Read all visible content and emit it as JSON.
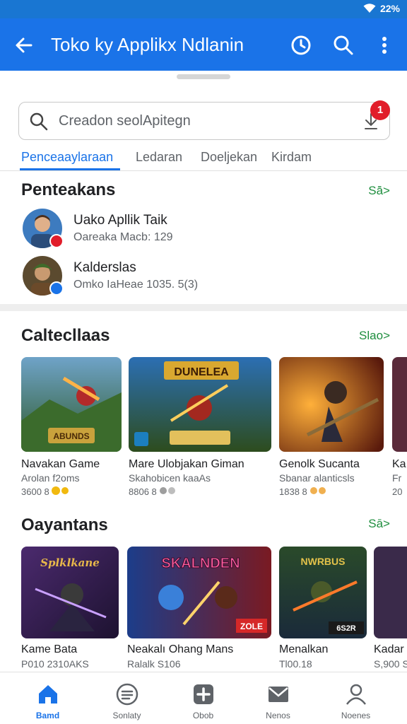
{
  "status": {
    "time": "22%"
  },
  "appbar": {
    "title": "Toko ky Applikx Ndlanin"
  },
  "search": {
    "placeholder": "Creadon seolApitegn",
    "badge": "1"
  },
  "tabs": [
    {
      "label": "Penceaaylaraan"
    },
    {
      "label": "Ledaran"
    },
    {
      "label": "Doeljekan"
    },
    {
      "label": "Kirdam"
    }
  ],
  "downloads": {
    "title": "Penteakans",
    "see_all": "Sā̄>",
    "items": [
      {
        "title": "Uako Apllik Taik",
        "sub": "Oareaka Macb: 129"
      },
      {
        "title": "Kalderslas",
        "sub": "Omko IaHeae 1035. 5(3)"
      }
    ]
  },
  "categories": {
    "title": "Caltecllaas",
    "see_all": "Slao>",
    "items": [
      {
        "title": "Navakan Game",
        "sub": "Arolan f2oms",
        "meta": "3600 8",
        "banner": "ABUNDS"
      },
      {
        "title": "Mare Ulobjakan Giman",
        "sub": "Skahobicen kaaAs",
        "meta": "8806 8",
        "banner": "DUNELEA"
      },
      {
        "title": "Genolk Sucanta",
        "sub": "Sbanar alanticsls",
        "meta": "1838 8",
        "banner": ""
      },
      {
        "title": "Ka",
        "sub": "Fr",
        "meta": "20",
        "banner": ""
      }
    ]
  },
  "popular": {
    "title": "Oayantans",
    "see_all": "Sā>",
    "items": [
      {
        "title": "Kame Bata",
        "sub": "P010 2310AKS",
        "banner": "Splklkane",
        "tag": ""
      },
      {
        "title": "Neakalı Ohang Mans",
        "sub": "Ralalk S106",
        "banner": "SKALNDEN",
        "tag": "ZOLE"
      },
      {
        "title": "Menalkan",
        "sub": "Tl00.18",
        "banner": "NWRBUS",
        "tag": "6S2R"
      },
      {
        "title": "Kadar",
        "sub": "S,900 S",
        "banner": "",
        "tag": ""
      }
    ]
  },
  "nav": [
    {
      "label": "Bamd",
      "icon": "home-icon"
    },
    {
      "label": "Sonlaty",
      "icon": "list-icon"
    },
    {
      "label": "Obob",
      "icon": "add-box-icon"
    },
    {
      "label": "Nenos",
      "icon": "mail-icon"
    },
    {
      "label": "Noenes",
      "icon": "profile-icon"
    }
  ],
  "colors": {
    "appbar": "#1a73e8",
    "accent_green": "#1e8e3e",
    "badge_red": "#e11d2a"
  }
}
